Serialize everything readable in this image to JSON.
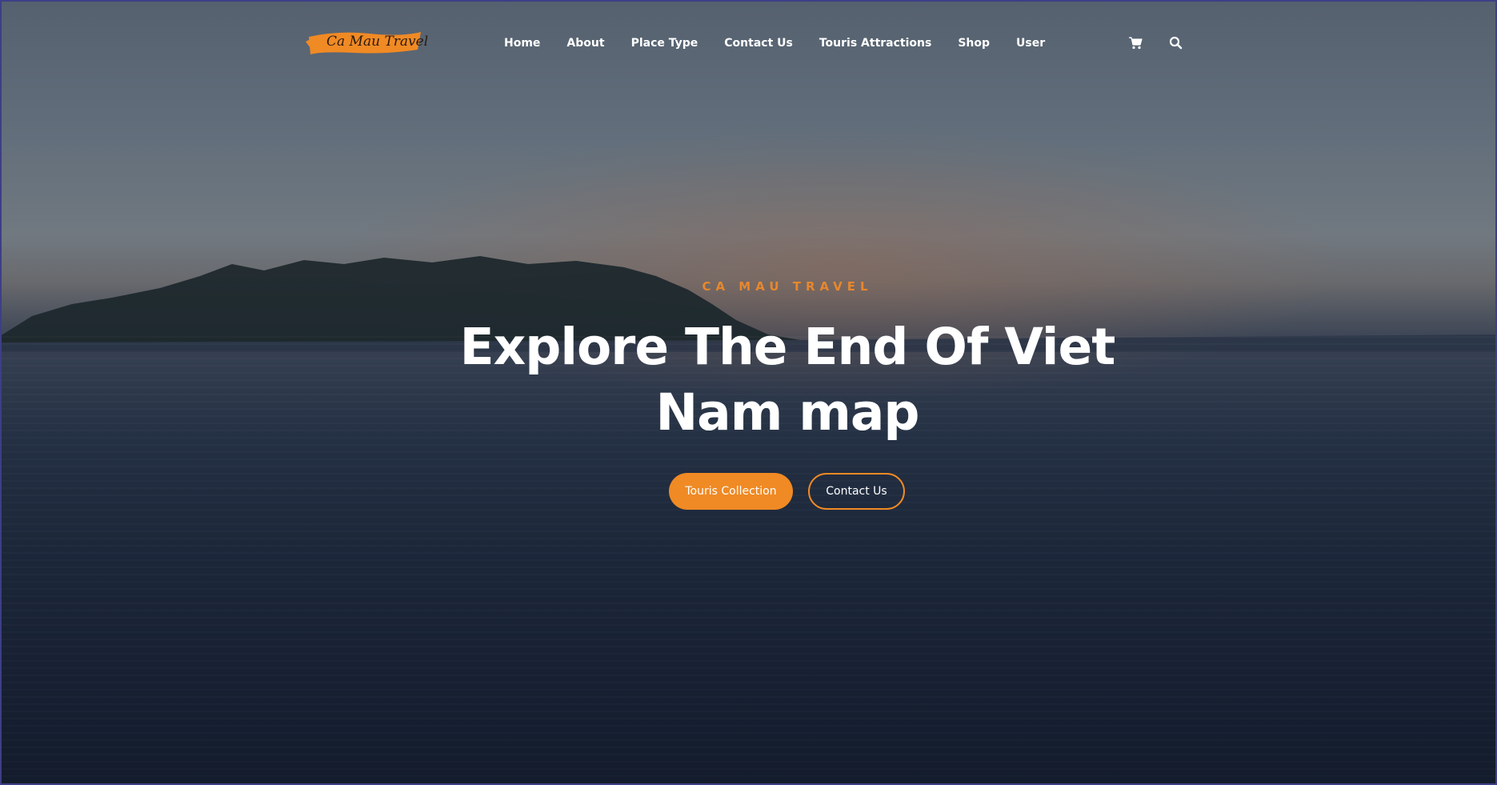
{
  "brand": {
    "logo_text": "Ca Mau Travel",
    "accent_color": "#f08a24"
  },
  "nav": {
    "items": [
      {
        "label": "Home"
      },
      {
        "label": "About"
      },
      {
        "label": "Place Type"
      },
      {
        "label": "Contact Us"
      },
      {
        "label": "Touris Attractions"
      },
      {
        "label": "Shop"
      },
      {
        "label": "User"
      }
    ],
    "icons": [
      "cart-icon",
      "search-icon"
    ]
  },
  "hero": {
    "kicker": "CA MAU TRAVEL",
    "headline": "Explore The End Of Viet Nam map",
    "primary_button": "Touris Collection",
    "secondary_button": "Contact Us"
  }
}
